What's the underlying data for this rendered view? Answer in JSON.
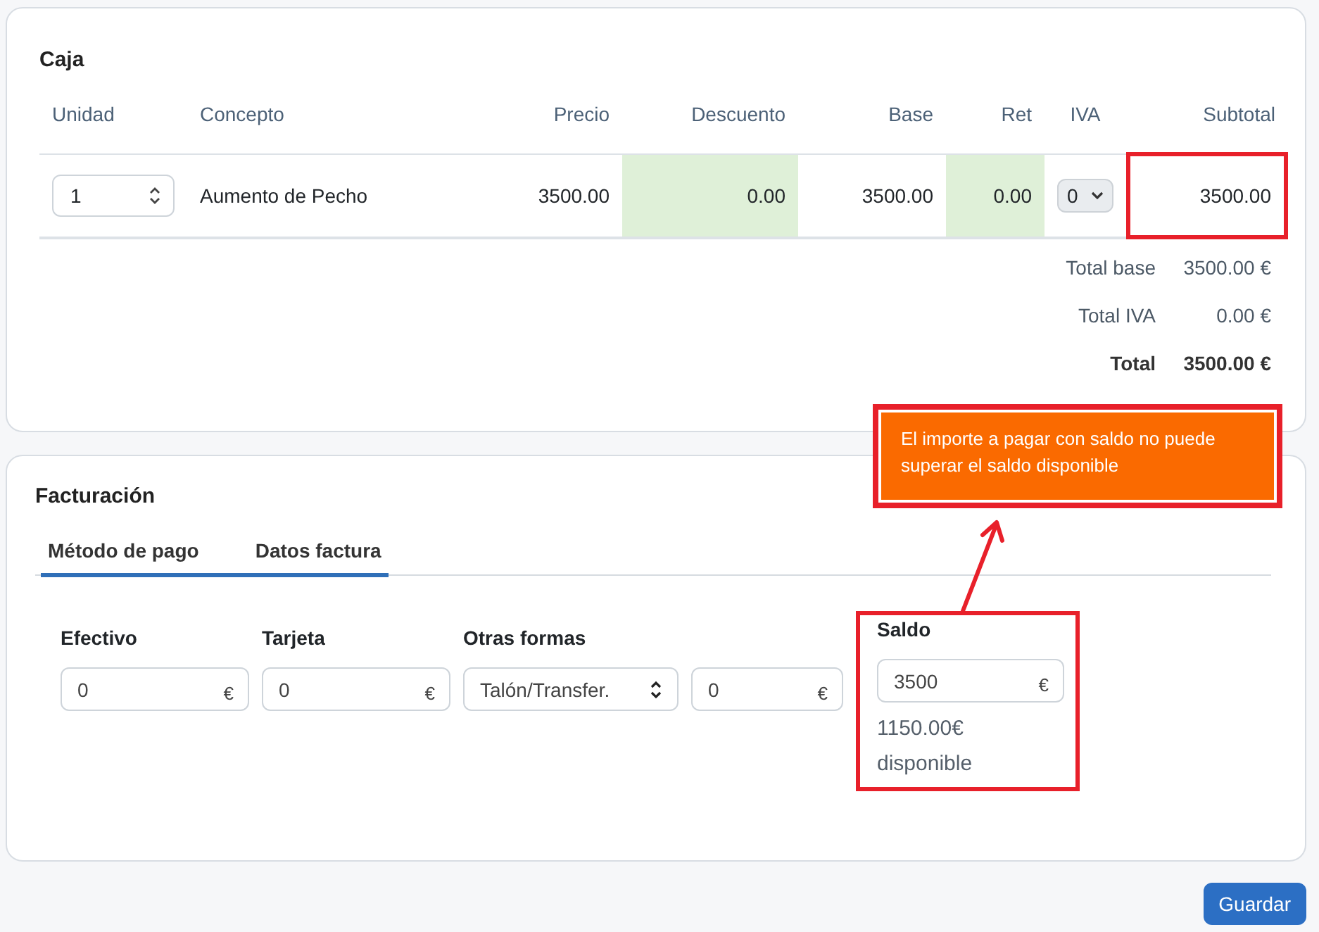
{
  "caja": {
    "title": "Caja",
    "columns": [
      {
        "label": "Unidad"
      },
      {
        "label": "Concepto"
      },
      {
        "label": "Precio"
      },
      {
        "label": "Descuento"
      },
      {
        "label": "Base"
      },
      {
        "label": "Ret"
      },
      {
        "label": "IVA"
      },
      {
        "label": "Subtotal"
      }
    ],
    "rows": [
      {
        "cells": [
          {
            "kind": "stepper",
            "value": "1"
          },
          {
            "kind": "text",
            "value": "Aumento de Pecho"
          },
          {
            "kind": "text",
            "value": "3500.00"
          },
          {
            "kind": "text",
            "value": "0.00",
            "shaded": true
          },
          {
            "kind": "text",
            "value": "3500.00"
          },
          {
            "kind": "text",
            "value": "0.00",
            "shaded": true
          },
          {
            "kind": "select",
            "value": "0"
          },
          {
            "kind": "text",
            "value": "3500.00",
            "highlighted": true
          }
        ]
      }
    ],
    "totals": [
      {
        "label": "Total base",
        "value": "3500.00 €",
        "bold": false
      },
      {
        "label": "Total IVA",
        "value": "0.00 €",
        "bold": false
      },
      {
        "label": "Total",
        "value": "3500.00 €",
        "bold": true
      }
    ]
  },
  "facturacion": {
    "title": "Facturación",
    "tabs": [
      {
        "label": "Método de pago"
      },
      {
        "label": "Datos factura"
      }
    ],
    "fields": [
      {
        "kind": "money",
        "label": "Efectivo",
        "value": "0",
        "unit": "€"
      },
      {
        "kind": "money",
        "label": "Tarjeta",
        "value": "0",
        "unit": "€"
      },
      {
        "kind": "select",
        "label": "Otras formas",
        "value": "Talón/Transfer."
      },
      {
        "kind": "money",
        "value": "0",
        "unit": "€"
      },
      {
        "kind": "money",
        "label": "Saldo",
        "value": "3500",
        "unit": "€",
        "note": "1150.00€ disponible",
        "highlighted": true
      }
    ]
  },
  "callout": {
    "text": "El importe a pagar con saldo no puede superar el saldo disponible"
  },
  "buttons": [
    {
      "label": "Guardar"
    }
  ]
}
